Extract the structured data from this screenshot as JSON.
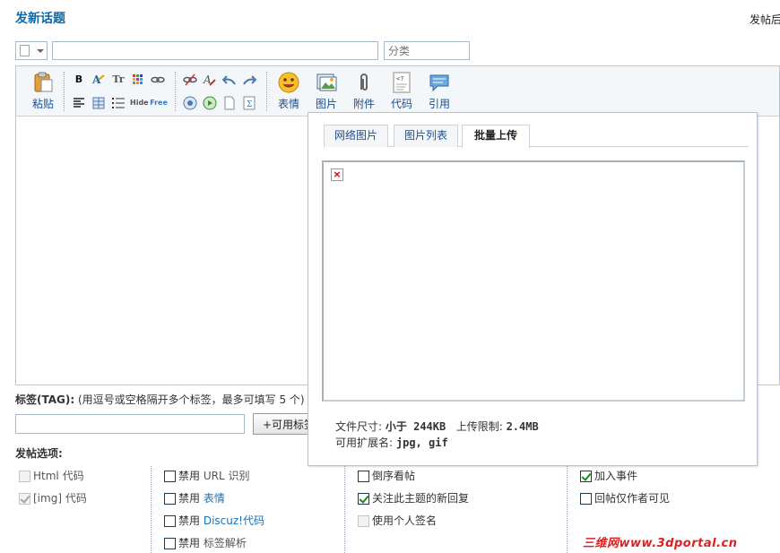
{
  "header": {
    "title": "发新话题",
    "right_note": "发帖后"
  },
  "form": {
    "category_placeholder": "分类"
  },
  "toolbar": {
    "paste": "粘贴",
    "emoticons": "表情",
    "image": "图片",
    "attachment": "附件",
    "code": "代码",
    "quote": "引用",
    "small_glyphs": {
      "bold": "B",
      "font": "Tr",
      "hide": "Hide",
      "free": "Free"
    }
  },
  "tags": {
    "label_bold": "标签(TAG):",
    "label_hint": " (用逗号或空格隔开多个标签，最多可填写 5 个)",
    "button": "+可用标签"
  },
  "options": {
    "title": "发帖选项:",
    "col1": [
      {
        "label": "Html 代码",
        "checked": false,
        "disabled": true
      },
      {
        "label": "[img] 代码",
        "checked": true,
        "disabled": true
      }
    ],
    "col2": [
      {
        "prefix": "禁用",
        "label": "URL 识别",
        "checked": false
      },
      {
        "prefix": "禁用",
        "label": "表情",
        "checked": false
      },
      {
        "prefix": "禁用",
        "label": "Discuz!代码",
        "checked": false
      },
      {
        "prefix": "禁用",
        "label": "标签解析",
        "checked": false
      }
    ],
    "col3": [
      {
        "label": "倒序看帖",
        "checked": false
      },
      {
        "label": "关注此主题的新回复",
        "checked": true
      },
      {
        "label": "使用个人签名",
        "checked": false,
        "disabled": true
      }
    ],
    "col4": [
      {
        "label": "加入事件",
        "checked": true
      },
      {
        "label": "回帖仅作者可见",
        "checked": false
      }
    ]
  },
  "image_popup": {
    "tabs": [
      "网络图片",
      "图片列表",
      "批量上传"
    ],
    "active_tab": 2,
    "file_size_label": "文件尺寸:",
    "file_size_value": "小于  244KB",
    "upload_limit_label": "上传限制:",
    "upload_limit_value": "2.4MB",
    "ext_label": "可用扩展名:",
    "ext_value": "jpg, gif"
  },
  "watermark": "三维网www.3dportal.cn",
  "colors": {
    "title_blue": "#0b6aa6",
    "link_blue": "#1f4e8a",
    "watermark_red": "#e02020"
  }
}
